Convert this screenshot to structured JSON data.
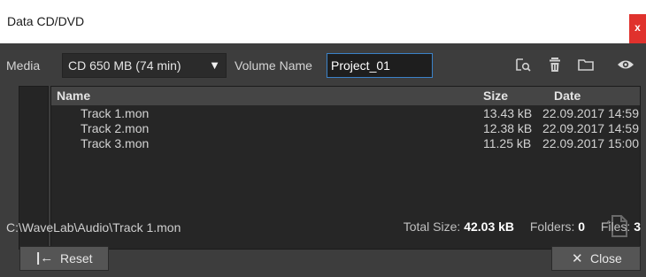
{
  "window": {
    "title": "Data CD/DVD",
    "close_glyph": "x"
  },
  "toolbar": {
    "media_label": "Media",
    "media_value": "CD 650 MB (74 min)",
    "dropdown_glyph": "▼",
    "volume_label": "Volume Name",
    "volume_value": "Project_01",
    "icons": [
      "browse-icon",
      "delete-icon",
      "folder-icon",
      "preview-icon"
    ]
  },
  "files": {
    "columns": {
      "name": "Name",
      "size": "Size",
      "date": "Date"
    },
    "rows": [
      {
        "name": "Track 1.mon",
        "size": "13.43 kB",
        "date": "22.09.2017 14:59"
      },
      {
        "name": "Track 2.mon",
        "size": "12.38 kB",
        "date": "22.09.2017 14:59"
      },
      {
        "name": "Track 3.mon",
        "size": "11.25 kB",
        "date": "22.09.2017 15:00"
      }
    ]
  },
  "status": {
    "path": "C:\\WaveLab\\Audio\\Track 1.mon",
    "total_size_label": "Total Size:",
    "total_size_value": "42.03 kB",
    "folders_label": "Folders:",
    "folders_value": "0",
    "files_label": "Files:",
    "files_value": "3"
  },
  "buttons": {
    "reset_icon": "|←",
    "reset_label": "Reset",
    "close_icon": "✕",
    "close_label": "Close"
  },
  "colors": {
    "accent": "#3a8fd6",
    "close_red": "#e0322d",
    "background": "#3d3d3d"
  }
}
